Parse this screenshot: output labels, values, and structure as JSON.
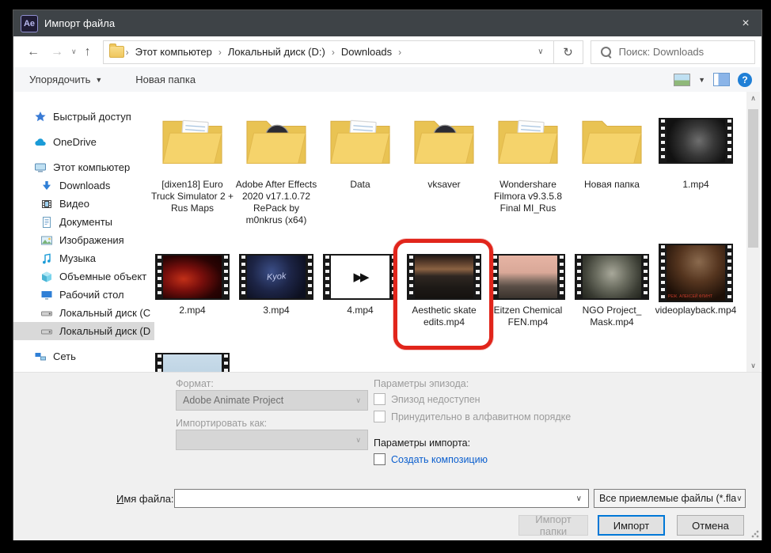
{
  "colors": {
    "titlebar_bg": "#3e4347",
    "accent_blue": "#0078d7",
    "annotation_red": "#e1251b",
    "link_blue": "#0b5fce",
    "folder_yellow": "#f5d36b",
    "help_blue": "#1f7fd6",
    "selected_gray": "#d9d9d9"
  },
  "window": {
    "app_icon_text": "Ae",
    "title": "Импорт файла",
    "close_glyph": "×"
  },
  "navbar": {
    "back_glyph": "←",
    "forward_glyph": "→",
    "history_glyph": "∨",
    "up_glyph": "↑",
    "address_dropdown_glyph": "∨",
    "refresh_glyph": "↻",
    "breadcrumb": [
      "Этот компьютер",
      "Локальный диск (D:)",
      "Downloads"
    ],
    "breadcrumb_sep": "›",
    "search_placeholder": "Поиск: Downloads"
  },
  "toolbar": {
    "organize_label": "Упорядочить",
    "organize_caret": "▼",
    "new_folder_label": "Новая папка",
    "view_caret": "▼",
    "help_glyph": "?"
  },
  "sidebar": {
    "items": [
      {
        "id": "quick-access",
        "label": "Быстрый доступ",
        "icon": "star",
        "level": 0,
        "group_start": false
      },
      {
        "id": "onedrive",
        "label": "OneDrive",
        "icon": "cloud",
        "level": 0,
        "group_start": true
      },
      {
        "id": "this-pc",
        "label": "Этот компьютер",
        "icon": "computer",
        "level": 0,
        "group_start": true
      },
      {
        "id": "downloads",
        "label": "Downloads",
        "icon": "download",
        "level": 1,
        "group_start": false
      },
      {
        "id": "videos",
        "label": "Видео",
        "icon": "video",
        "level": 1,
        "group_start": false
      },
      {
        "id": "documents",
        "label": "Документы",
        "icon": "document",
        "level": 1,
        "group_start": false
      },
      {
        "id": "pictures",
        "label": "Изображения",
        "icon": "picture",
        "level": 1,
        "group_start": false
      },
      {
        "id": "music",
        "label": "Музыка",
        "icon": "music",
        "level": 1,
        "group_start": false
      },
      {
        "id": "objects-3d",
        "label": "Объемные объект",
        "icon": "cube",
        "level": 1,
        "group_start": false
      },
      {
        "id": "desktop",
        "label": "Рабочий стол",
        "icon": "desktop",
        "level": 1,
        "group_start": false
      },
      {
        "id": "local-disk-c",
        "label": "Локальный диск (C",
        "icon": "disk",
        "level": 1,
        "group_start": false
      },
      {
        "id": "local-disk-d",
        "label": "Локальный диск (D",
        "icon": "disk",
        "level": 1,
        "group_start": false,
        "selected": true
      },
      {
        "id": "network",
        "label": "Сеть",
        "icon": "network",
        "level": 0,
        "group_start": true
      }
    ]
  },
  "files": [
    {
      "name": "[dixen18] Euro Truck Simulator 2 + Rus Maps",
      "type": "folder",
      "variant": "papers"
    },
    {
      "name": "Adobe After Effects 2020 v17.1.0.72 RePack by m0nkrus (x64)",
      "type": "folder",
      "variant": "disc"
    },
    {
      "name": "Data",
      "type": "folder",
      "variant": "papers"
    },
    {
      "name": "vksaver",
      "type": "folder",
      "variant": "disc"
    },
    {
      "name": "Wondershare Filmora v9.3.5.8 Final MI_Rus",
      "type": "folder",
      "variant": "papers"
    },
    {
      "name": "Новая папка",
      "type": "folder",
      "variant": "empty"
    },
    {
      "name": "1.mp4",
      "type": "video",
      "thumb": "radial-gradient(circle at 55% 50%, #6e6e6e 0%, #383838 40%, #111111 80%)"
    },
    {
      "name": "2.mp4",
      "type": "video",
      "thumb": "radial-gradient(ellipse at 35% 55%, #c23018 0%, #7a0f0c 35%, #2a0303 70%, #150101 100%)"
    },
    {
      "name": "3.mp4",
      "type": "video",
      "thumb": "radial-gradient(circle at 42% 38%, #3c4f88 0%, #1d2547 45%, #0d1020 85%)",
      "overlay": "Kyok",
      "overlay_class": "ov-kyok"
    },
    {
      "name": "4.mp4",
      "type": "video",
      "thumb": "#ffffff",
      "overlay": "▶▶",
      "overlay_class": "ov-play"
    },
    {
      "name": "Aesthetic skate edits.mp4",
      "type": "video",
      "thumb": "linear-gradient(180deg,#241a16 0%,#6b4a33 22%,#8a6243 32%,#2f2722 48%,#1d1916 75%,#15120f 100%)",
      "highlighted": true
    },
    {
      "name": "Eitzen Chemical FEN.mp4",
      "type": "video",
      "thumb": "linear-gradient(180deg,#e6b4a4 0%,#d9a898 40%,#8a7468 58%,#5a4e46 72%,#3a332d 100%)"
    },
    {
      "name": "NGO Project_ Mask.mp4",
      "type": "video",
      "thumb": "radial-gradient(circle at 50% 42%, #a8a89a 0%, #6b6d60 40%, #3a3c33 75%, #22241d 100%)"
    },
    {
      "name": "videoplayback.mp4",
      "type": "video",
      "thumb": "radial-gradient(circle at 55% 30%, #8a6a4e 0%, #55351f 40%, #1d0f07 80%)",
      "tall": true,
      "overlay": "РЕЖ. АЛЕКСЕЙ ФЛИНТ",
      "overlay_class": "ov-credit"
    },
    {
      "name": "",
      "type": "video",
      "thumb": "linear-gradient(180deg,#c9dcea 0%,#bcd2e2 60%,#ded8c8 78%,#cfc9b8 100%)"
    }
  ],
  "form": {
    "format_label": "Формат:",
    "format_value": "Adobe Animate Project",
    "dropdown_glyph": "∨",
    "import_as_label": "Импортировать как:",
    "episode_options_label": "Параметры эпизода:",
    "episode_unavailable_label": "Эпизод недоступен",
    "force_alphabetical_label": "Принудительно в алфавитном порядке",
    "import_options_label": "Параметры импорта:",
    "create_composition_label": "Создать композицию",
    "filename_label_key": "И",
    "filename_label_rest": "мя файла:",
    "filename_value": "",
    "filetype_value": "Все приемлемые файлы (*.fla",
    "import_folder_button": "Импорт папки",
    "import_button": "Импорт",
    "cancel_button": "Отмена"
  },
  "scrollbar": {
    "up_glyph": "∧",
    "down_glyph": "∨"
  }
}
